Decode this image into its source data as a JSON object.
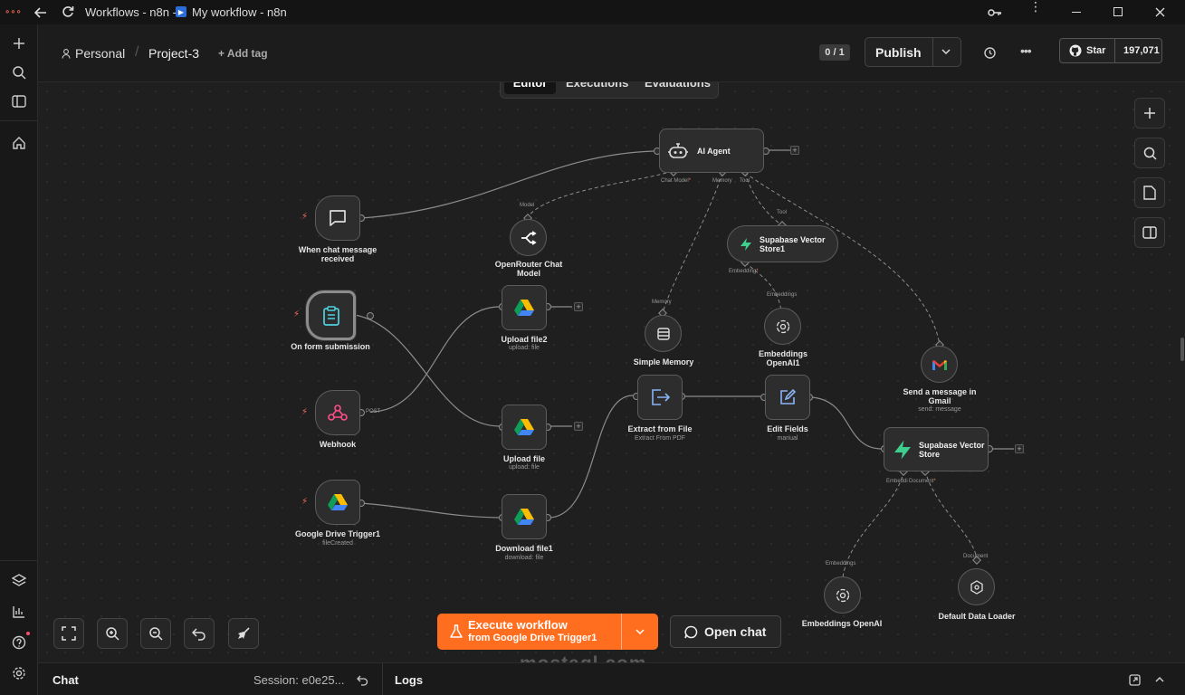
{
  "window": {
    "title": "Workflows - n8n - ",
    "tab_title": "My workflow - n8n"
  },
  "header": {
    "project": "Personal",
    "workflow_name": "Project-3",
    "add_tag": "+ Add tag",
    "version": "0 / 1",
    "publish": "Publish",
    "star": "Star",
    "star_count": "197,071"
  },
  "tabs": [
    {
      "label": "Editor",
      "active": true
    },
    {
      "label": "Executions",
      "active": false
    },
    {
      "label": "Evaluations",
      "active": false
    }
  ],
  "nodes": {
    "ai_agent": {
      "label": "AI Agent",
      "ports": [
        "Chat Model",
        "Memory",
        "Tool"
      ]
    },
    "chat_trigger": {
      "label": "When chat message received"
    },
    "openrouter": {
      "label": "OpenRouter Chat Model",
      "port": "Model"
    },
    "supabase_vs1": {
      "label": "Supabase Vector Store1",
      "port_top": "Tool",
      "port_bottom": "Embedding"
    },
    "form_trigger": {
      "label": "On form submission"
    },
    "upload_file2": {
      "label": "Upload file2",
      "sub": "upload: file"
    },
    "simple_memory": {
      "label": "Simple Memory",
      "port": "Memory"
    },
    "embeddings_openai1": {
      "label": "Embeddings OpenAI1",
      "port": "Embeddings"
    },
    "gmail": {
      "label": "Send a message in Gmail",
      "sub": "send: message"
    },
    "webhook": {
      "label": "Webhook",
      "port": "POST"
    },
    "upload_file": {
      "label": "Upload file",
      "sub": "upload: file"
    },
    "extract": {
      "label": "Extract from File",
      "sub": "Extract From PDF"
    },
    "edit_fields": {
      "label": "Edit Fields",
      "sub": "manual"
    },
    "supabase_vs": {
      "label": "Supabase Vector Store",
      "port_a": "Embeddi",
      "port_b": "Document"
    },
    "gdrive_trigger": {
      "label": "Google Drive Trigger1",
      "sub": "fileCreated"
    },
    "download_file": {
      "label": "Download file1",
      "sub": "download: file"
    },
    "embeddings_openai": {
      "label": "Embeddings OpenAI",
      "port": "Embeddings"
    },
    "data_loader": {
      "label": "Default Data Loader",
      "port": "Document"
    }
  },
  "execute": {
    "label": "Execute workflow",
    "sub": "from Google Drive Trigger1"
  },
  "open_chat": "Open chat",
  "bottom": {
    "chat": "Chat",
    "session": "Session: e0e25...",
    "logs": "Logs"
  },
  "watermark": "mostaql.com",
  "colors": {
    "accent": "#ff6d5a",
    "execute": "#ff6d1f",
    "background": "#1f1f1f"
  }
}
